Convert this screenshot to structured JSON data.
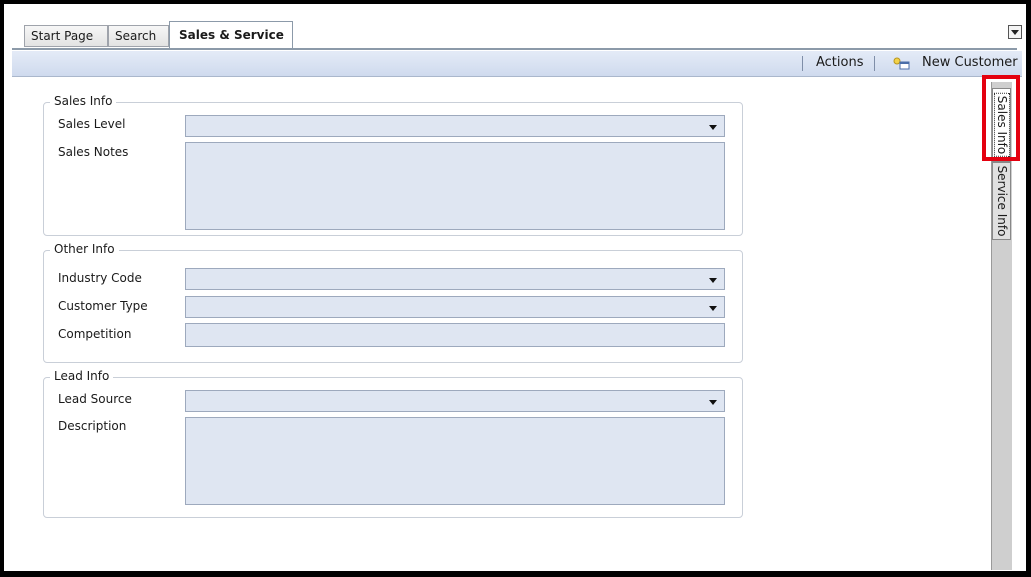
{
  "tabs": [
    {
      "label": "Start Page"
    },
    {
      "label": "Search"
    },
    {
      "label": "Sales & Service",
      "active": true
    }
  ],
  "toolbar": {
    "actions_label": "Actions",
    "new_customer_label": "New Customer",
    "new_customer_icon": "new-record-icon"
  },
  "side_tabs": [
    {
      "label": "Sales Info",
      "selected": true
    },
    {
      "label": "Service Info"
    }
  ],
  "groups": {
    "sales_info": {
      "title": "Sales Info",
      "sales_level": {
        "label": "Sales Level",
        "value": ""
      },
      "sales_notes": {
        "label": "Sales Notes",
        "value": ""
      }
    },
    "other_info": {
      "title": "Other Info",
      "industry_code": {
        "label": "Industry Code",
        "value": ""
      },
      "customer_type": {
        "label": "Customer Type",
        "value": ""
      },
      "competition": {
        "label": "Competition",
        "value": ""
      }
    },
    "lead_info": {
      "title": "Lead Info",
      "lead_source": {
        "label": "Lead Source",
        "value": ""
      },
      "description": {
        "label": "Description",
        "value": ""
      }
    }
  },
  "colors": {
    "highlight": "#e4000f",
    "field_fill": "#dfe6f2",
    "toolbar_fill": "#cfdaee"
  }
}
